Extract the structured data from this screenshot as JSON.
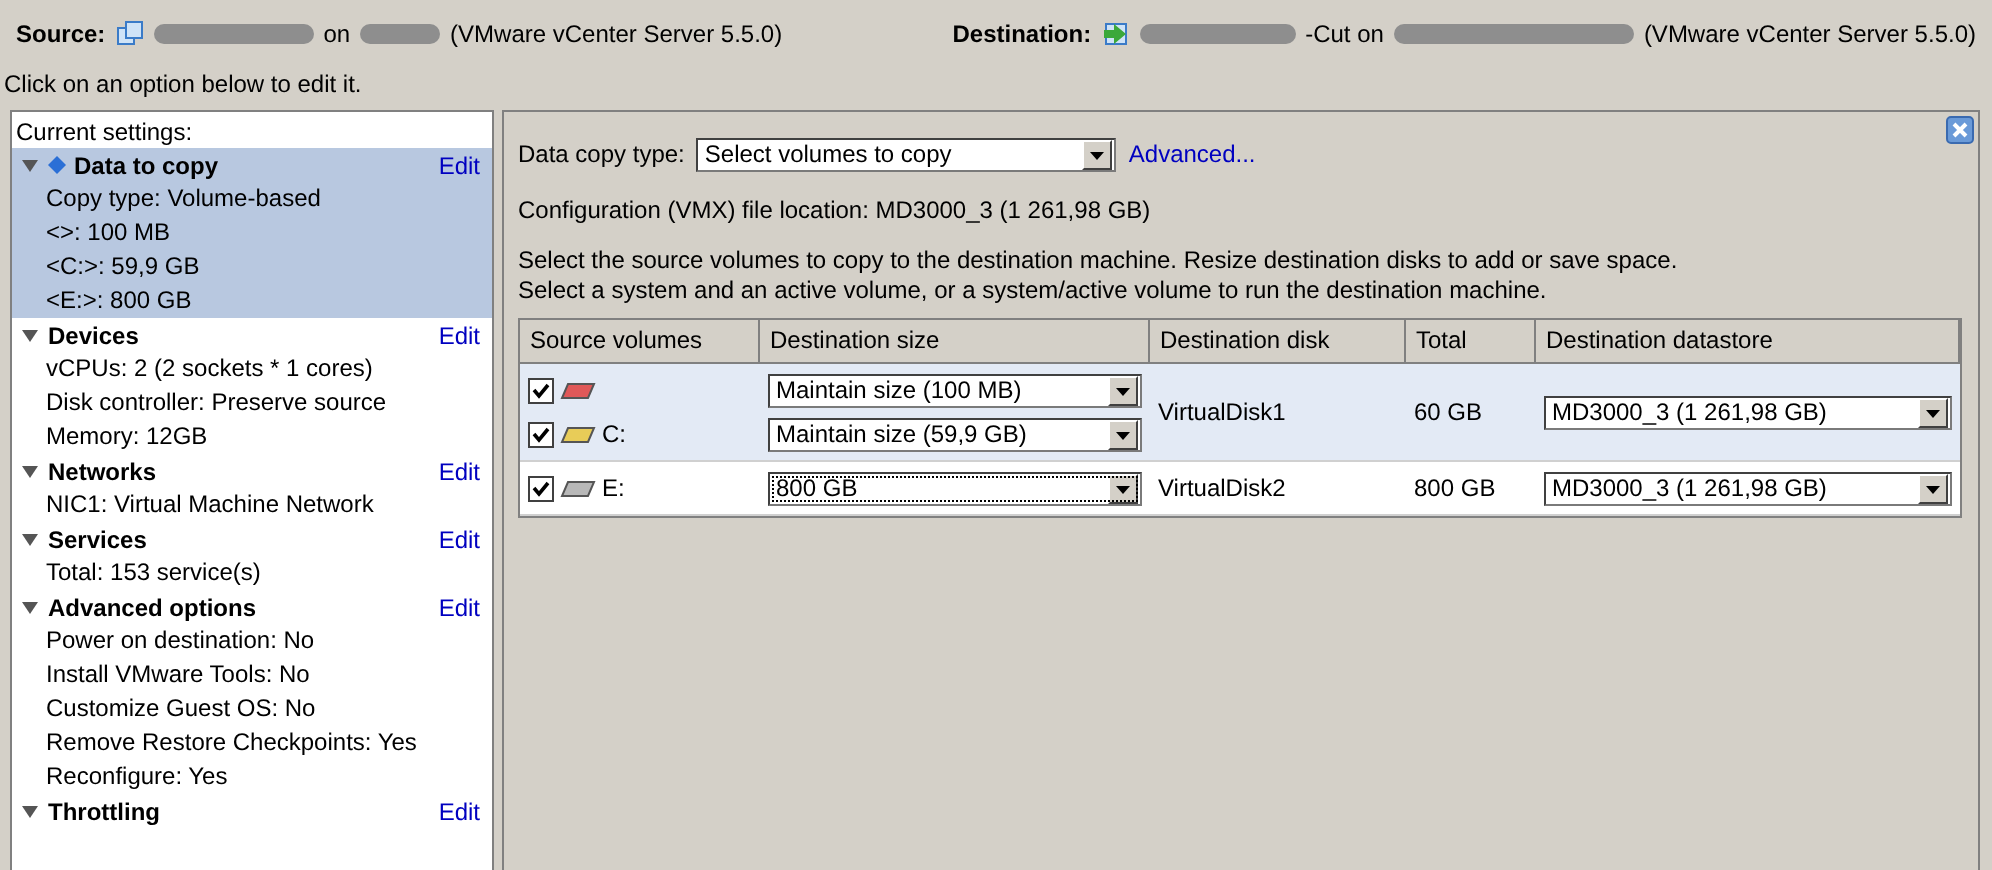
{
  "header": {
    "source": {
      "label": "Source:",
      "on": "on",
      "server": "(VMware vCenter Server 5.5.0)"
    },
    "destination": {
      "label": "Destination:",
      "suffix": "-Cut on",
      "server": "(VMware vCenter Server 5.5.0)"
    }
  },
  "hint": "Click on an option below to edit it.",
  "settings": {
    "title": "Current settings:",
    "sections": [
      {
        "title": "Data to copy",
        "selected": true,
        "expanded": true,
        "edit": "Edit",
        "items": [
          "Copy type: Volume-based",
          "<>: 100 MB",
          "<C:>: 59,9 GB",
          "<E:>: 800 GB"
        ]
      },
      {
        "title": "Devices",
        "selected": false,
        "expanded": true,
        "edit": "Edit",
        "items": [
          "vCPUs: 2 (2 sockets * 1 cores)",
          "Disk controller: Preserve source",
          "Memory: 12GB"
        ]
      },
      {
        "title": "Networks",
        "selected": false,
        "expanded": true,
        "edit": "Edit",
        "items": [
          "NIC1: Virtual Machine Network"
        ]
      },
      {
        "title": "Services",
        "selected": false,
        "expanded": true,
        "edit": "Edit",
        "items": [
          "Total: 153 service(s)"
        ]
      },
      {
        "title": "Advanced options",
        "selected": false,
        "expanded": true,
        "edit": "Edit",
        "items": [
          "Power on destination: No",
          "Install VMware Tools: No",
          "Customize Guest OS: No",
          "Remove Restore Checkpoints: Yes",
          "Reconfigure: Yes"
        ]
      },
      {
        "title": "Throttling",
        "selected": false,
        "expanded": true,
        "edit": "Edit"
      }
    ]
  },
  "panel": {
    "copy_type_label": "Data copy type:",
    "copy_type_value": "Select volumes to copy",
    "advanced_link": "Advanced...",
    "config_location": "Configuration (VMX) file location: MD3000_3 (1 261,98 GB)",
    "instructions": [
      "Select the source volumes to copy to the destination machine. Resize destination disks to add or save space.",
      "Select a system and an active volume, or a system/active volume to run the destination machine."
    ],
    "table": {
      "columns": [
        "Source volumes",
        "Destination size",
        "Destination disk",
        "Total",
        "Destination datastore"
      ],
      "disks": [
        {
          "selected": true,
          "disk": "VirtualDisk1",
          "total": "60 GB",
          "datastore": "MD3000_3 (1 261,98 GB)",
          "volumes": [
            {
              "checked": true,
              "color": "#e05858",
              "size": "Maintain size (100 MB)",
              "focused": false
            },
            {
              "checked": true,
              "color": "#e8cc58",
              "label": "C:",
              "size": "Maintain size (59,9 GB)",
              "focused": false
            }
          ]
        },
        {
          "selected": false,
          "disk": "VirtualDisk2",
          "total": "800 GB",
          "datastore": "MD3000_3 (1 261,98 GB)",
          "volumes": [
            {
              "checked": true,
              "color": "#b8b8b8",
              "label": "E:",
              "size": "800 GB",
              "focused": true
            }
          ]
        }
      ]
    }
  }
}
